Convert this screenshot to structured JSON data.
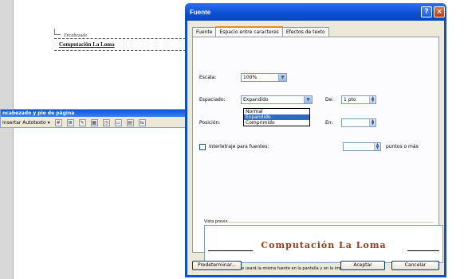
{
  "document": {
    "header_label": "Encabezado",
    "header_text": "Computación La Loma"
  },
  "hf_toolbar": {
    "title": "ncabezado y pie de página",
    "insert_autotext": "Insertar Autotexto ▾",
    "icons": [
      "page-number-icon",
      "page-count-icon",
      "format-page-number-icon",
      "insert-date-icon",
      "insert-time-icon",
      "page-setup-icon",
      "show-hide-text-icon",
      "same-as-previous-icon"
    ]
  },
  "dialog": {
    "title": "Fuente",
    "tabs": [
      "Fuente",
      "Espacio entre caracteres",
      "Efectos de texto"
    ],
    "active_tab": 1,
    "escala": {
      "label": "Escala:",
      "value": "100%"
    },
    "espaciado": {
      "label": "Espaciado:",
      "value": "Expandido"
    },
    "espaciado_por": {
      "label": "De:",
      "value": "1 pto"
    },
    "posicion": {
      "label": "Posición:"
    },
    "posicion_en": {
      "label": "En:",
      "value": ""
    },
    "espaciado_options": [
      "Normal",
      "Expandido",
      "Comprimido"
    ],
    "espaciado_selected": 1,
    "kerning": {
      "label": "Interletraje para fuentes:",
      "value": "",
      "suffix": "puntos o más",
      "checked": false
    },
    "preview_label": "Vista previa",
    "preview_text": "Computación La Loma",
    "preview_note": "Fuente TrueType. Se usará la misma fuente en la pantalla y en la impresora.",
    "buttons": {
      "default": "Predeterminar...",
      "ok": "Aceptar",
      "cancel": "Cancelar"
    }
  },
  "colors": {
    "titlebar": "#0b4fd3",
    "preview_text": "#9c3a16",
    "selection": "#316ac5"
  }
}
